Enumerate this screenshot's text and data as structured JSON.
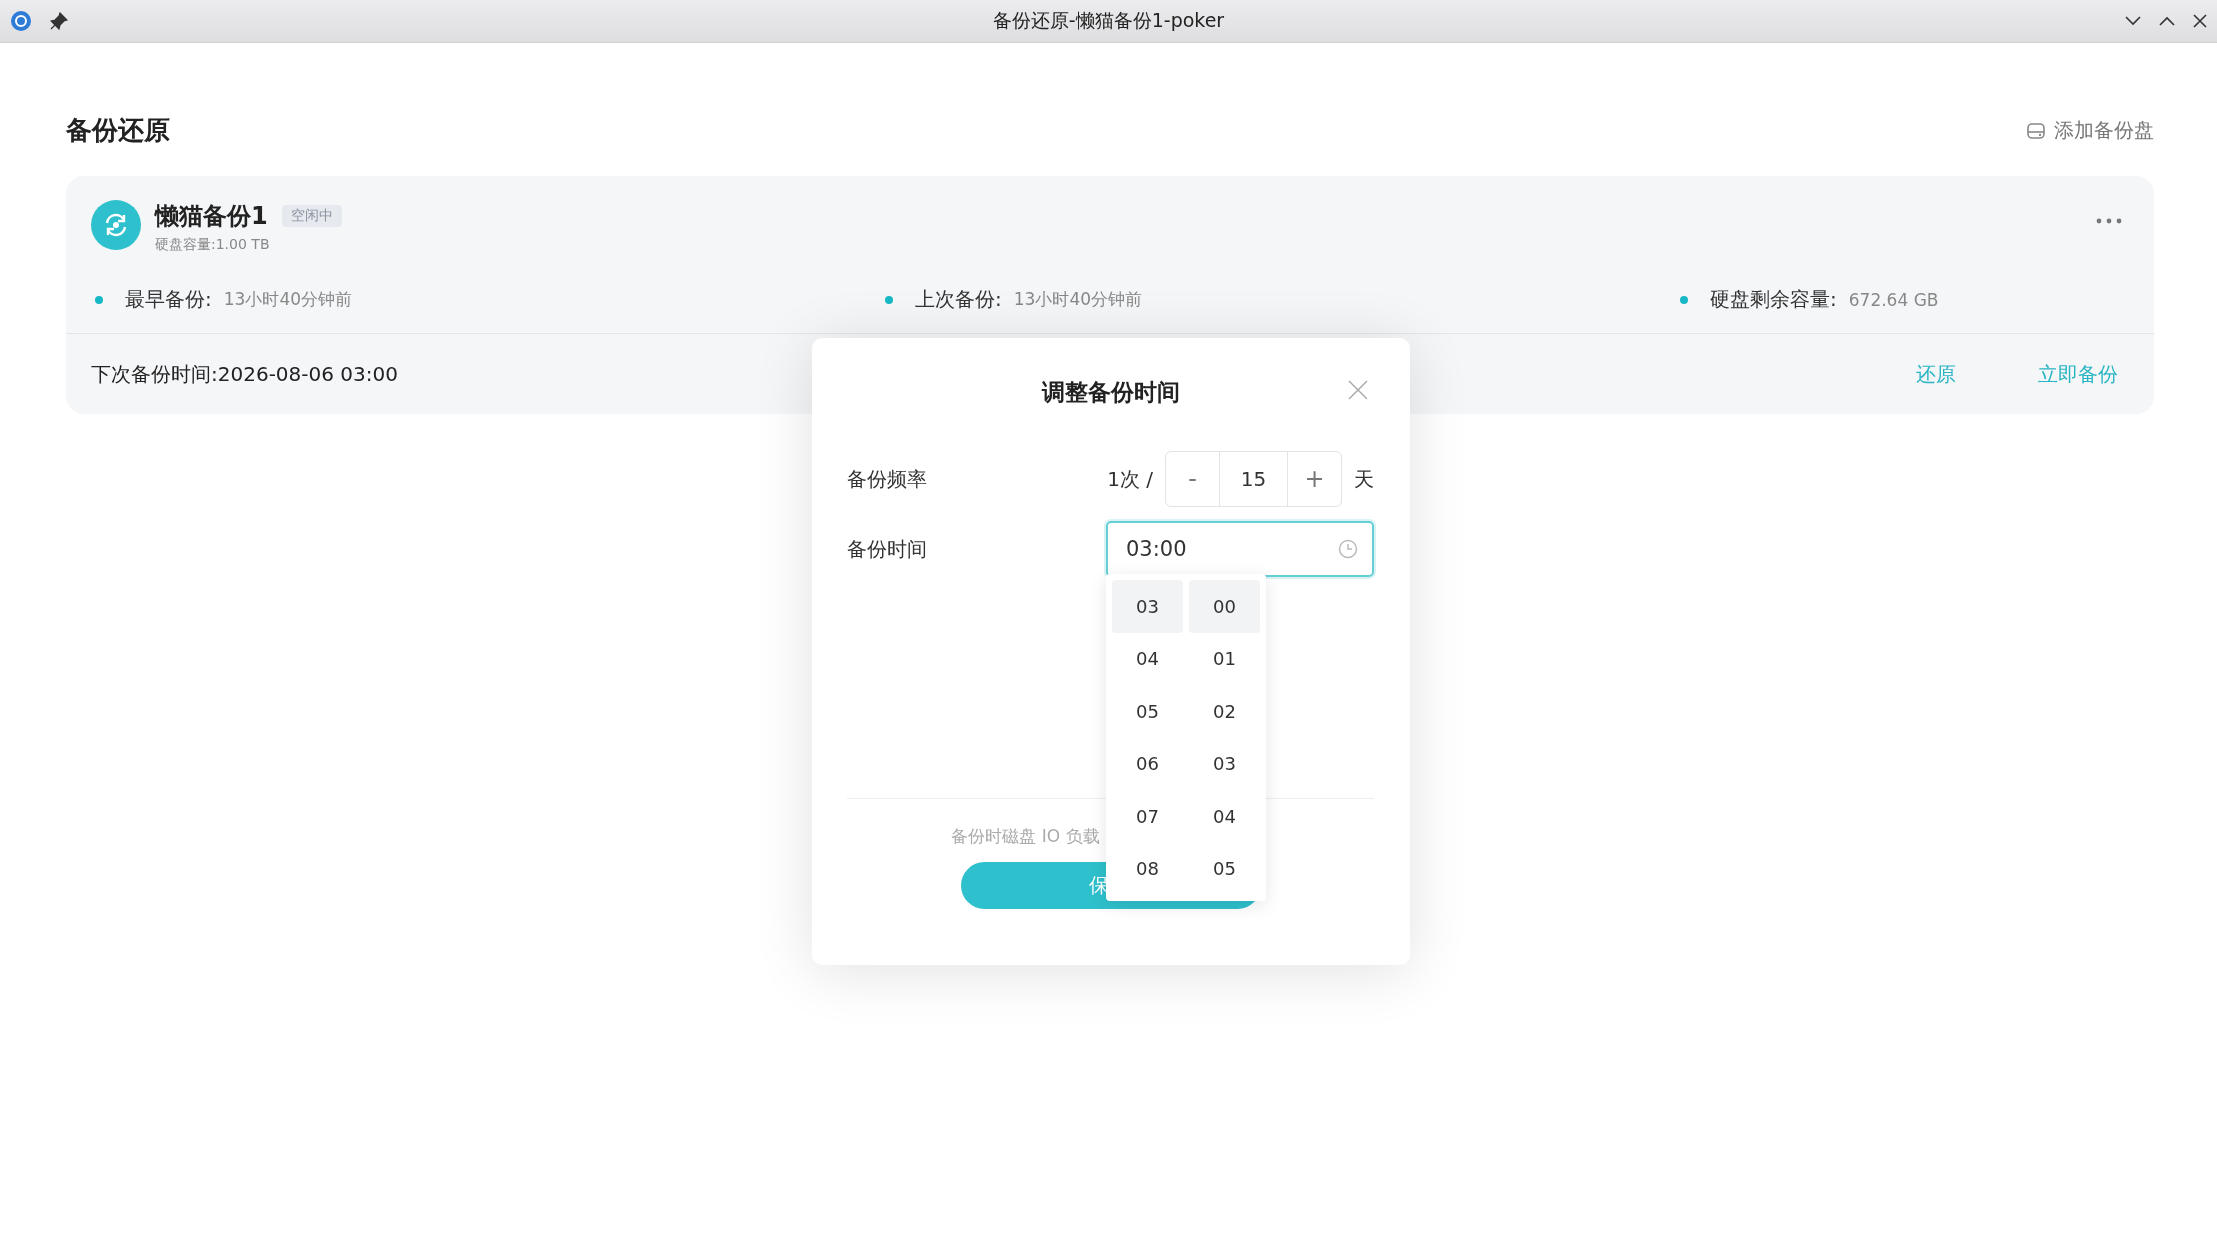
{
  "window": {
    "title": "备份还原-懒猫备份1-poker"
  },
  "page": {
    "title": "备份还原",
    "add_button": "添加备份盘"
  },
  "backup": {
    "name": "懒猫备份1",
    "status": "空闲中",
    "capacity": "硬盘容量:1.00 TB",
    "stats": [
      {
        "label": "最早备份:",
        "value": "13小时40分钟前"
      },
      {
        "label": "上次备份:",
        "value": "13小时40分钟前"
      },
      {
        "label": "硬盘剩余容量:",
        "value": "672.64 GB"
      }
    ],
    "next_backup": "下次备份时间:2026-08-06 03:00",
    "actions": [
      "还原",
      "立即备份"
    ]
  },
  "dialog": {
    "title": "调整备份时间",
    "frequency": {
      "label": "备份频率",
      "prefix": "1次 /",
      "decrement": "-",
      "value": "15",
      "increment": "+",
      "unit": "天"
    },
    "time": {
      "label": "备份时间",
      "value": "03:00"
    },
    "picker": {
      "hours": [
        {
          "label": "03",
          "selected": true
        },
        {
          "label": "04",
          "selected": false
        },
        {
          "label": "05",
          "selected": false
        },
        {
          "label": "06",
          "selected": false
        },
        {
          "label": "07",
          "selected": false
        },
        {
          "label": "08",
          "selected": false
        }
      ],
      "minutes": [
        {
          "label": "00",
          "selected": true
        },
        {
          "label": "01",
          "selected": false
        },
        {
          "label": "02",
          "selected": false
        },
        {
          "label": "03",
          "selected": false
        },
        {
          "label": "04",
          "selected": false
        },
        {
          "label": "05",
          "selected": false
        }
      ]
    },
    "hint": "备份时磁盘 IO 负载",
    "save": "保"
  }
}
